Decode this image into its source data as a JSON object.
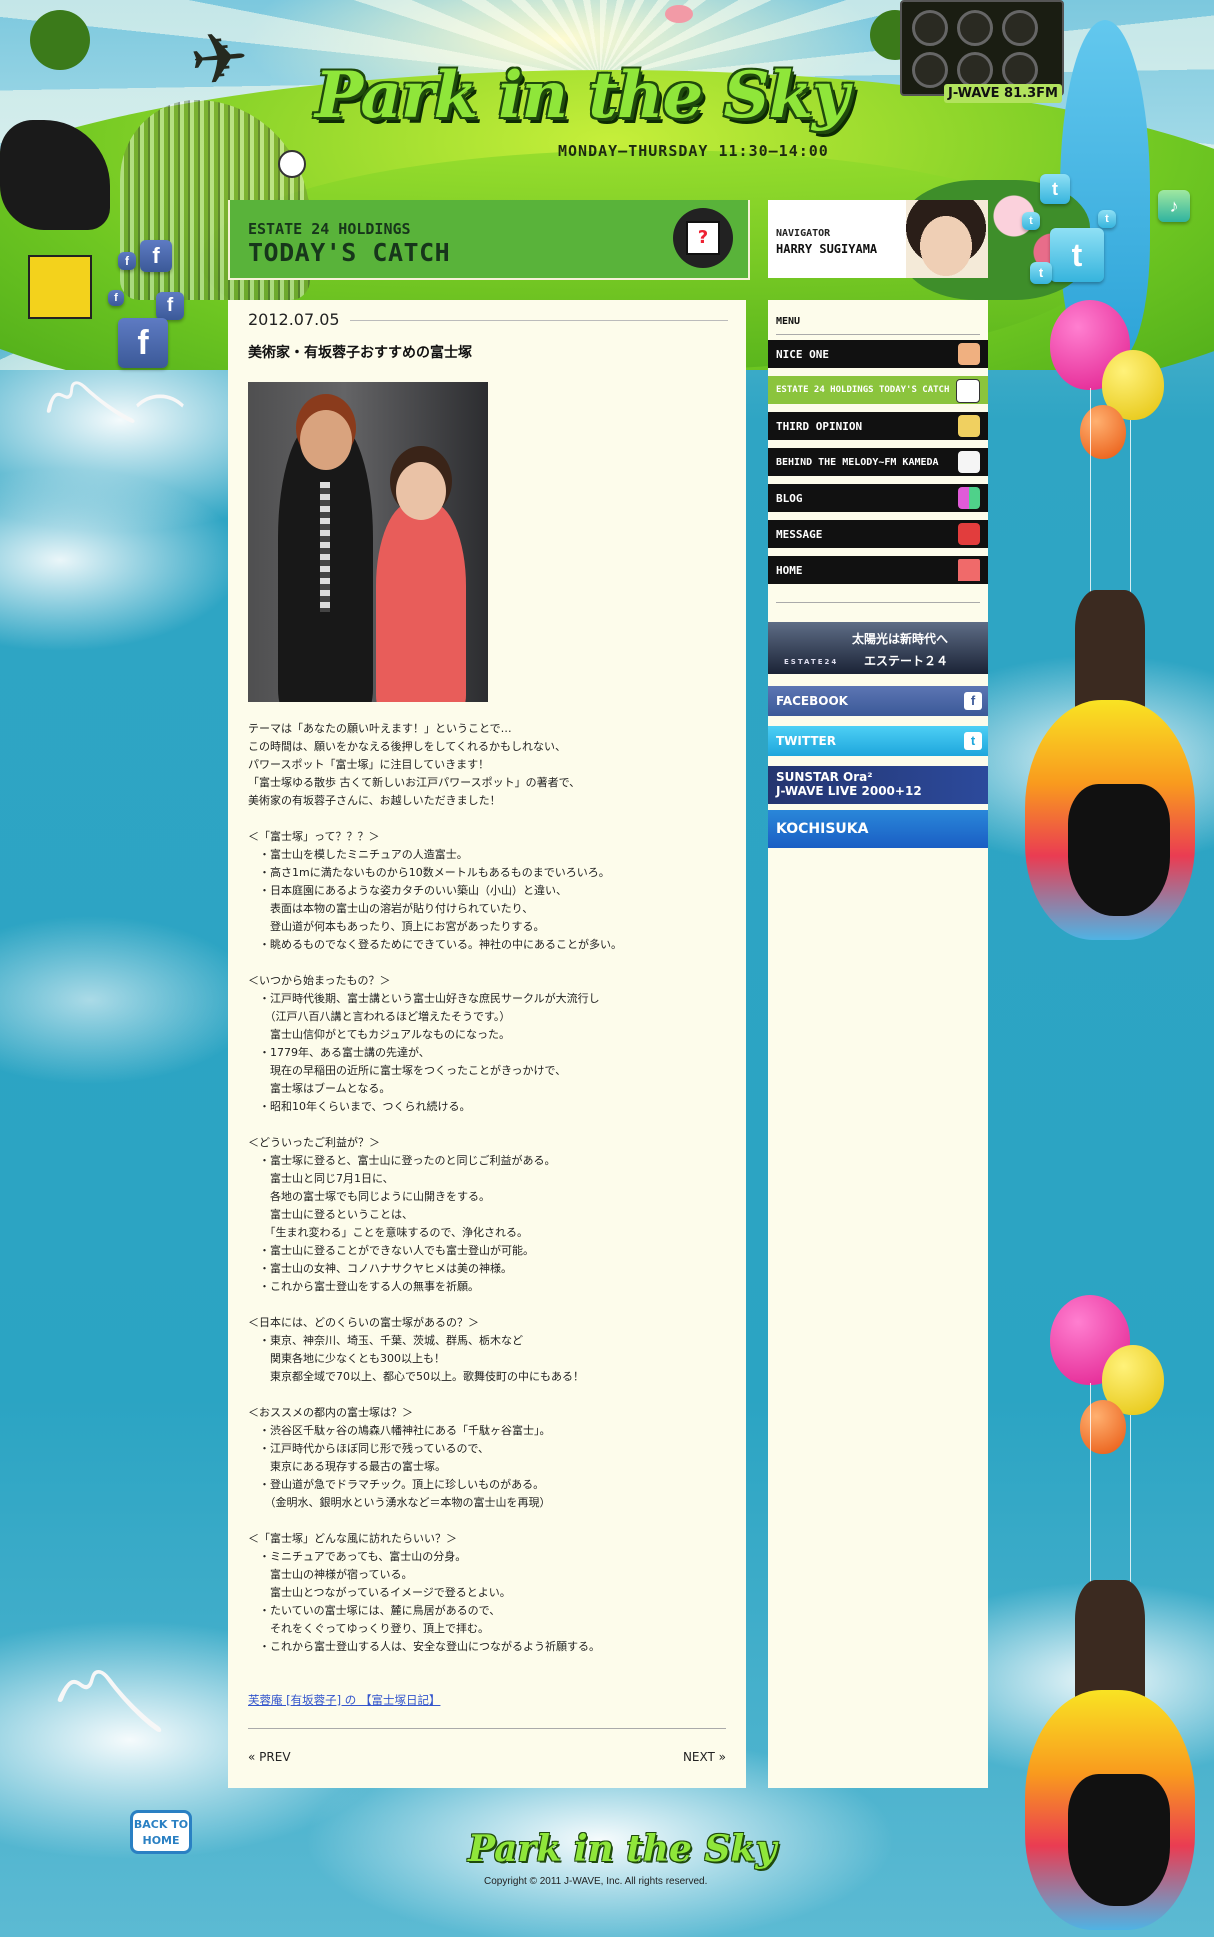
{
  "header": {
    "logo": "Park in the Sky",
    "airtime": "MONDAY–THURSDAY 11:30–14:00",
    "station": "J-WAVE 81.3FM"
  },
  "titlebar": {
    "sponsor": "ESTATE 24 HOLDINGS",
    "title": "TODAY'S CATCH",
    "icon": "mystery-box-icon"
  },
  "navigator": {
    "label": "NAVIGATOR",
    "name": "HARRY SUGIYAMA"
  },
  "article": {
    "date": "2012.07.05",
    "title": "美術家・有坂蓉子おすすめの富士塚",
    "body": "テーマは「あなたの願い叶えます！」ということで…\nこの時間は、願いをかなえる後押しをしてくれるかもしれない、\nパワースポット「富士塚」に注目していきます！\n「富士塚ゆる散歩 古くて新しいお江戸パワースポット」の著者で、\n美術家の有坂蓉子さんに、お越しいただきました！\n\n＜「富士塚」って？？？＞\n　・富士山を模したミニチュアの人造富士。\n　・高さ1mに満たないものから10数メートルもあるものまでいろいろ。\n　・日本庭園にあるような姿カタチのいい築山（小山）と違い、\n　　表面は本物の富士山の溶岩が貼り付けられていたり、\n　　登山道が何本もあったり、頂上にお宮があったりする。\n　・眺めるものでなく登るためにできている。神社の中にあることが多い。\n\n＜いつから始まったもの？＞\n　・江戸時代後期、富士講という富士山好きな庶民サークルが大流行し\n　　（江戸八百八講と言われるほど増えたそうです。）\n　　富士山信仰がとてもカジュアルなものになった。\n　・1779年、ある富士講の先達が、\n　　現在の早稲田の近所に富士塚をつくったことがきっかけで、\n　　富士塚はブームとなる。\n　・昭和10年くらいまで、つくられ続ける。\n\n＜どういったご利益が？＞\n　・富士塚に登ると、富士山に登ったのと同じご利益がある。\n　　富士山と同じ7月1日に、\n　　各地の富士塚でも同じように山開きをする。\n　　富士山に登るということは、\n　　「生まれ変わる」ことを意味するので、浄化される。\n　・富士山に登ることができない人でも富士登山が可能。\n　・富士山の女神、コノハナサクヤヒメは美の神様。\n　・これから富士登山をする人の無事を祈願。\n\n＜日本には、どのくらいの富士塚があるの？＞\n　・東京、神奈川、埼玉、千葉、茨城、群馬、栃木など\n　　関東各地に少なくとも300以上も！\n　　東京都全域で70以上、都心で50以上。歌舞伎町の中にもある！\n\n＜おススメの都内の富士塚は？＞\n　・渋谷区千駄ヶ谷の鳩森八幡神社にある「千駄ヶ谷富士」。\n　・江戸時代からほぼ同じ形で残っているので、\n　　東京にある現存する最古の富士塚。\n　・登山道が急でドラマチック。頂上に珍しいものがある。\n　　（金明水、銀明水という湧水など＝本物の富士山を再現）\n\n＜「富士塚」どんな風に訪れたらいい？＞\n　・ミニチュアであっても、富士山の分身。\n　　富士山の神様が宿っている。\n　　富士山とつながっているイメージで登るとよい。\n　・たいていの富士塚には、麓に鳥居があるので、\n　　それをくぐってゆっくり登り、頂上で拝む。\n　・これから富士登山する人は、安全な登山につながるよう祈願する。",
    "link": "芙蓉庵 [有坂蓉子] の 【富士塚日記】",
    "prev": "« PREV",
    "next": "NEXT »"
  },
  "sidebar": {
    "menu_heading": "MENU",
    "items": [
      {
        "label": "NICE ONE",
        "icon": "thumbs-up-icon",
        "color": "#f0b080"
      },
      {
        "label": "ESTATE 24 HOLDINGS TODAY'S CATCH",
        "icon": "mystery-box-icon",
        "color": "#ffffff",
        "active": true
      },
      {
        "label": "THIRD OPINION",
        "icon": "megaphone-icon",
        "color": "#f0d060"
      },
      {
        "label": "BEHIND THE MELODY~FM KAMEDA",
        "icon": "guitar-icon",
        "color": "#f5f5f5"
      },
      {
        "label": "BLOG",
        "icon": "blocks-icon",
        "color": "#e05bd8"
      },
      {
        "label": "MESSAGE",
        "icon": "at-icon",
        "color": "#e23d3d"
      },
      {
        "label": "HOME",
        "icon": "house-icon",
        "color": "#f06a6a"
      }
    ],
    "banners": {
      "estate_line1": "太陽光は新時代へ",
      "estate_line2": "エステート２４",
      "estate_logo": "ESTATE24",
      "facebook": "FACEBOOK",
      "twitter": "TWITTER",
      "sunstar_line1": "SUNSTAR Ora²",
      "sunstar_line2": "J-WAVE LIVE 2000+12",
      "kochisuka": "KOCHISUKA"
    }
  },
  "footer": {
    "back_to_home": "BACK TO HOME",
    "logo": "Park in the Sky",
    "copyright": "Copyright © 2011 J-WAVE, Inc. All rights reserved."
  }
}
